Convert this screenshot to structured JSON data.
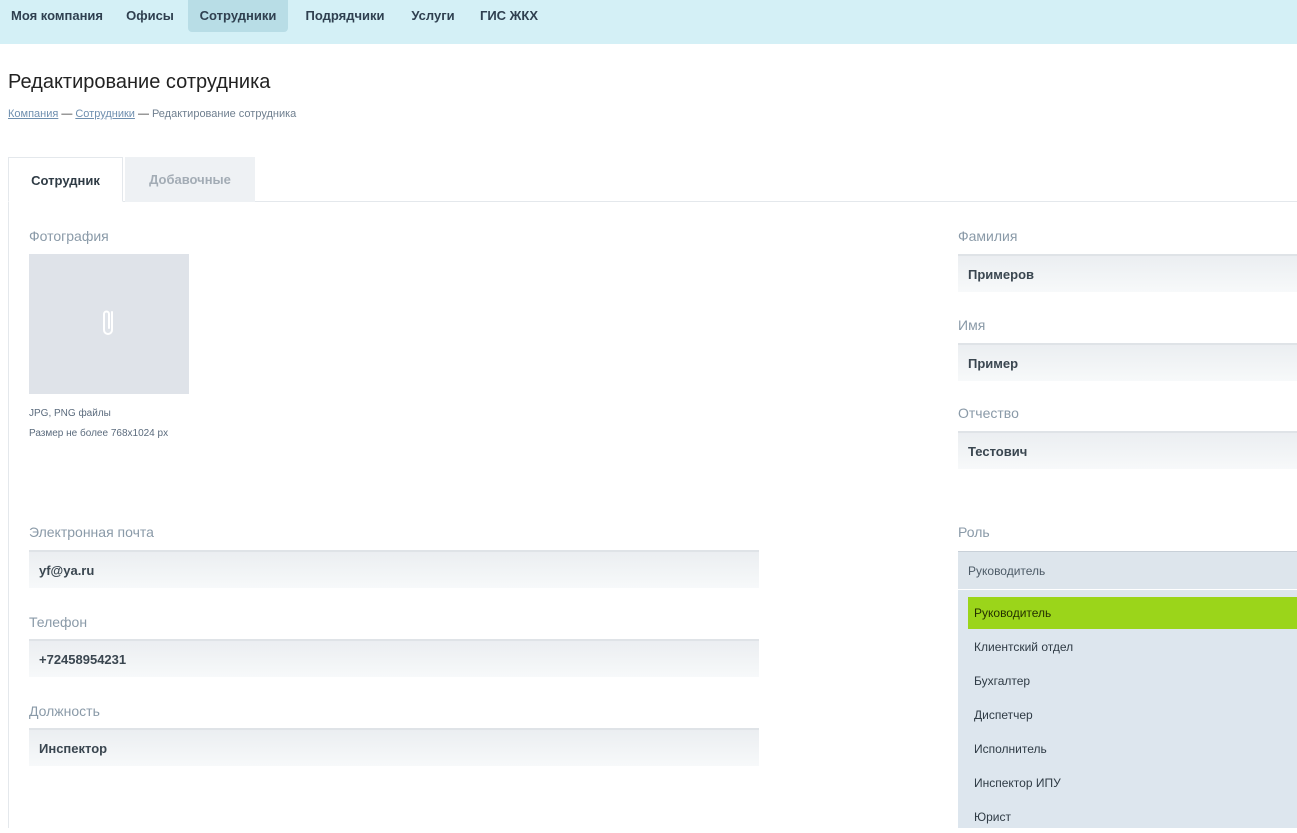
{
  "nav": {
    "items": [
      {
        "label": "Моя компания"
      },
      {
        "label": "Офисы"
      },
      {
        "label": "Сотрудники"
      },
      {
        "label": "Подрядчики"
      },
      {
        "label": "Услуги"
      },
      {
        "label": "ГИС ЖКХ"
      }
    ],
    "active": "Сотрудники"
  },
  "page": {
    "title": "Редактирование сотрудника",
    "breadcrumbs": [
      {
        "label": "Компания"
      },
      {
        "label": "Сотрудники"
      },
      {
        "label": "Редактирование сотрудника"
      }
    ],
    "crumb_separator": "—"
  },
  "tabs": [
    {
      "label": "Сотрудник"
    },
    {
      "label": "Добавочные"
    }
  ],
  "photo": {
    "label": "Фотография",
    "hint_formats": "JPG, PNG файлы",
    "hint_size": "Размер не более 768x1024 px",
    "icon": "paperclip-icon"
  },
  "fields": {
    "last_name": {
      "label": "Фамилия",
      "value": "Примеров"
    },
    "first_name": {
      "label": "Имя",
      "value": "Пример"
    },
    "patronymic": {
      "label": "Отчество",
      "value": "Тестович"
    },
    "email": {
      "label": "Электронная почта",
      "value": "yf@ya.ru"
    },
    "phone": {
      "label": "Телефон",
      "value": "+72458954231"
    },
    "position": {
      "label": "Должность",
      "value": "Инспектор"
    }
  },
  "role": {
    "label": "Роль",
    "selected": "Руководитель",
    "options": [
      {
        "label": "Руководитель"
      },
      {
        "label": "Клиентский отдел"
      },
      {
        "label": "Бухгалтер"
      },
      {
        "label": "Диспетчер"
      },
      {
        "label": "Исполнитель"
      },
      {
        "label": "Инспектор ИПУ"
      },
      {
        "label": "Юрист"
      }
    ]
  },
  "colors": {
    "nav_bg": "#d4f0f6",
    "selected_option": "#9bd51a"
  }
}
